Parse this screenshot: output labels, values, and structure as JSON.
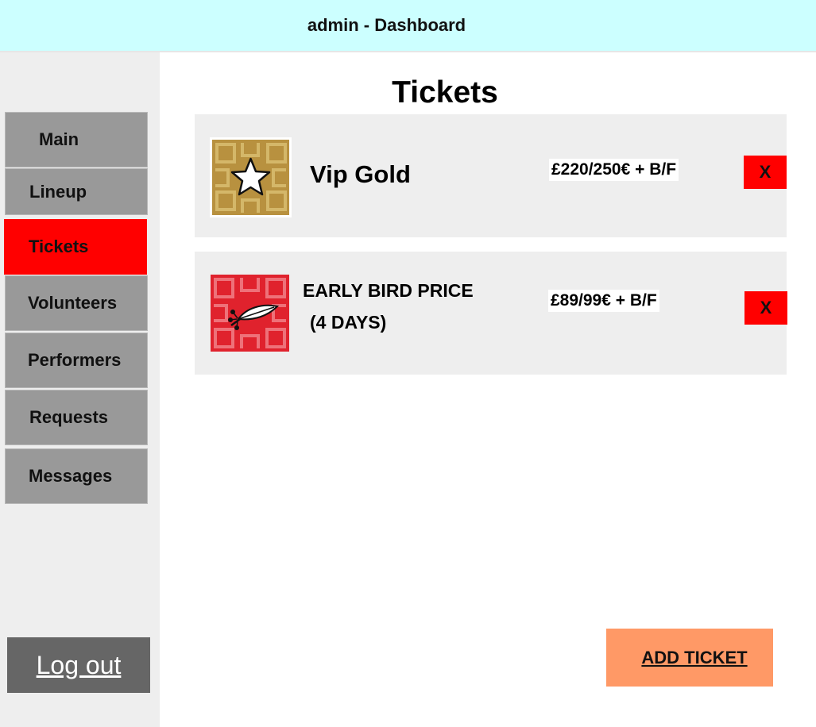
{
  "header": {
    "title": "admin - Dashboard"
  },
  "sidebar": {
    "items": [
      {
        "label": "Main"
      },
      {
        "label": "Lineup"
      },
      {
        "label": "Tickets",
        "active": true
      },
      {
        "label": "Volunteers"
      },
      {
        "label": "Performers"
      },
      {
        "label": "Requests"
      },
      {
        "label": "Messages"
      }
    ],
    "logout_label": "Log out"
  },
  "main": {
    "title": "Tickets",
    "tickets": [
      {
        "name": "Vip Gold",
        "price": "£220/250€ + B/F",
        "delete_label": "X",
        "icon": "star-icon",
        "image_color": "#b8913f"
      },
      {
        "name_line1": "EARLY BIRD PRICE",
        "name_line2": "(4 DAYS)",
        "price": "£89/99€ + B/F",
        "delete_label": "X",
        "icon": "feather-icon",
        "image_color": "#e0222d"
      }
    ],
    "add_label": "ADD TICKET"
  },
  "colors": {
    "header_bg": "#ccffff",
    "sidebar_bg": "#eeeeee",
    "nav_bg": "#999999",
    "nav_active": "#ff0000",
    "logout_bg": "#666666",
    "delete_bg": "#ff0000",
    "add_bg": "#ff9966"
  }
}
